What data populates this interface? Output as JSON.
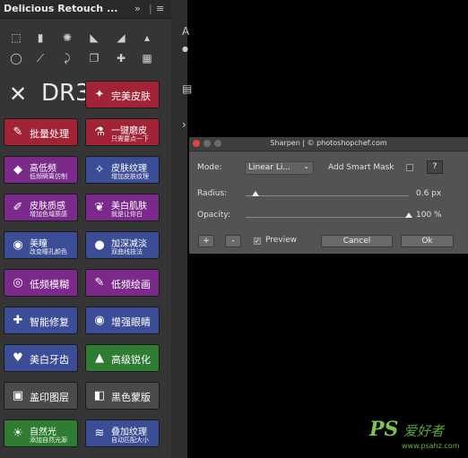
{
  "panel": {
    "title": "Delicious Retouch ...",
    "expand_glyph": "»",
    "menu_glyph": "≡",
    "logo": "DR3"
  },
  "buttons": [
    {
      "name": "perfect-skin-button",
      "icon": "face-icon",
      "glyph": "✦",
      "title": "完美皮肤",
      "color": "red"
    },
    {
      "name": "batch-process-button",
      "icon": "brush-icon",
      "glyph": "✎",
      "title": "批量处理",
      "color": "red"
    },
    {
      "name": "one-key-smooth-button",
      "icon": "bottle-icon",
      "glyph": "⚗",
      "title": "一键磨皮",
      "sub": "只需要点一下",
      "color": "red"
    },
    {
      "name": "high-low-freq-button",
      "icon": "diamond-icon",
      "glyph": "◆",
      "title": "高低频",
      "sub": "低频瞬离仿制",
      "color": "purple"
    },
    {
      "name": "skin-texture-button",
      "icon": "spray-icon",
      "glyph": "✧",
      "title": "皮肤纹理",
      "sub": "增加皮肤纹理",
      "color": "blue"
    },
    {
      "name": "skin-quality-button",
      "icon": "pen-icon",
      "glyph": "✐",
      "title": "皮肤质感",
      "sub": "增加色域质感",
      "color": "purple"
    },
    {
      "name": "whiten-skin-button",
      "icon": "feather-icon",
      "glyph": "❦",
      "title": "美白肌肤",
      "sub": "就是让你白",
      "color": "purple"
    },
    {
      "name": "beauty-pupil-button",
      "icon": "pupil-icon",
      "glyph": "◉",
      "title": "美瞳",
      "sub": "改变瞳孔颜色",
      "color": "blue"
    },
    {
      "name": "deepen-button",
      "icon": "sphere-icon",
      "glyph": "●",
      "title": "加深减淡",
      "sub": "双曲线技法",
      "color": "blue"
    },
    {
      "name": "low-freq-blur-button",
      "icon": "eye-blur-icon",
      "glyph": "◎",
      "title": "低频模糊",
      "color": "purple"
    },
    {
      "name": "low-freq-paint-button",
      "icon": "brush-icon",
      "glyph": "✎",
      "title": "低频绘画",
      "color": "purple"
    },
    {
      "name": "smart-repair-button",
      "icon": "bandage-icon",
      "glyph": "✚",
      "title": "智能修复",
      "color": "blue"
    },
    {
      "name": "enhance-eyes-button",
      "icon": "eye-icon",
      "glyph": "◉",
      "title": "增强眼睛",
      "color": "blue"
    },
    {
      "name": "whiten-teeth-button",
      "icon": "tooth-icon",
      "glyph": "♥",
      "title": "美白牙齿",
      "color": "blue"
    },
    {
      "name": "advanced-sharpen-button",
      "icon": "triangle-icon",
      "glyph": "▲",
      "title": "高级锐化",
      "color": "green"
    },
    {
      "name": "stamp-layer-button",
      "icon": "layers-icon",
      "glyph": "▣",
      "title": "盖印图层",
      "color": "gray"
    },
    {
      "name": "black-mask-button",
      "icon": "mask-icon",
      "glyph": "◧",
      "title": "黑色蒙版",
      "color": "gray"
    },
    {
      "name": "natural-light-button",
      "icon": "sun-icon",
      "glyph": "☀",
      "title": "自然光",
      "sub": "添加自然光源",
      "color": "green"
    },
    {
      "name": "overlay-texture-button",
      "icon": "texture-icon",
      "glyph": "≋",
      "title": "叠加纹理",
      "sub": "自动匹配大小",
      "color": "blue"
    }
  ],
  "dialog": {
    "title": "Sharpen | © photoshopchef.com",
    "mode_label": "Mode:",
    "mode_value": "Linear Li...",
    "smart_mask_label": "Add Smart Mask",
    "help_label": "?",
    "radius_label": "Radius:",
    "radius_value": "0.6 px",
    "radius_fraction": 0.06,
    "opacity_label": "Opacity:",
    "opacity_value": "100 %",
    "opacity_fraction": 1.0,
    "plus_label": "+",
    "minus_label": "-",
    "preview_label": "Preview",
    "preview_checked": true,
    "cancel_label": "Cancel",
    "ok_label": "Ok"
  },
  "watermark": {
    "brand": "PS",
    "cn": "爱好者",
    "url": "www.psahz.com"
  }
}
